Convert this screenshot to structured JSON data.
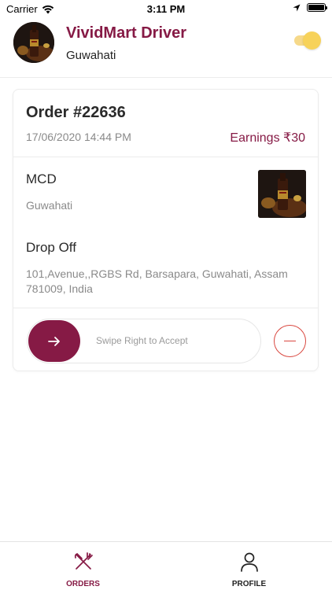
{
  "status_bar": {
    "carrier": "Carrier",
    "time": "3:11 PM",
    "battery_level": 1.0
  },
  "header": {
    "title": "VividMart Driver",
    "city": "Guwahati",
    "online_toggle": true,
    "avatar_icon": "driver-avatar-image"
  },
  "order": {
    "number": "Order #22636",
    "datetime": "17/06/2020 14:44 PM",
    "earnings": "Earnings ₹30",
    "pickup": {
      "name": "MCD",
      "city": "Guwahati"
    },
    "drop": {
      "title": "Drop Off",
      "address": "101,Avenue,,RGBS Rd, Barsapara, Guwahati, Assam 781009, India"
    },
    "swipe_label": "Swipe Right to Accept"
  },
  "tabs": [
    {
      "label": "ORDERS",
      "icon": "fork-knife-icon",
      "active": true
    },
    {
      "label": "PROFILE",
      "icon": "person-icon",
      "active": false
    }
  ],
  "colors": {
    "brand": "#861a45",
    "reject": "#d9473f",
    "toggle": "#f7d25a"
  }
}
